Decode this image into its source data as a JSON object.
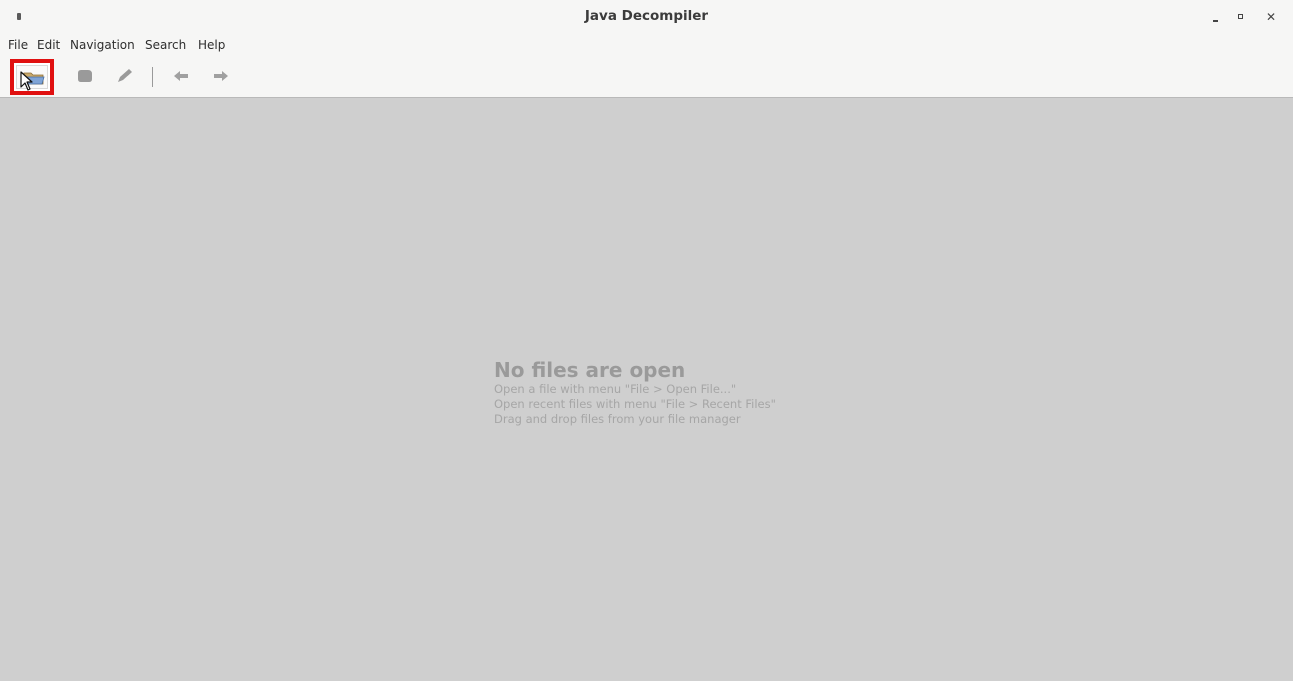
{
  "window": {
    "title": "Java Decompiler"
  },
  "menu": {
    "items": [
      "File",
      "Edit",
      "Navigation",
      "Search",
      "Help"
    ]
  },
  "toolbar": {
    "buttons": [
      {
        "name": "open-file",
        "icon": "folder-icon",
        "highlighted": true
      },
      {
        "name": "save",
        "icon": "save-icon"
      },
      {
        "name": "edit",
        "icon": "pencil-icon"
      },
      {
        "name": "back",
        "icon": "arrow-left-icon"
      },
      {
        "name": "forward",
        "icon": "arrow-right-icon"
      }
    ],
    "highlight_color": "#e01010"
  },
  "main": {
    "empty_title": "No files are open",
    "hints": [
      "Open a file with menu \"File > Open File...\"",
      "Open recent files with menu \"File > Recent Files\"",
      "Drag and drop files from your file manager"
    ]
  }
}
